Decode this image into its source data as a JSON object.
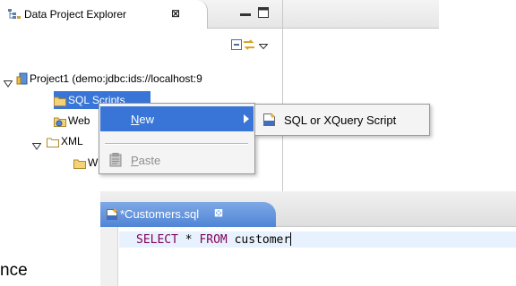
{
  "explorer": {
    "tab_title": "Data Project Explorer",
    "tab_close_glyph": "⊠",
    "tree": {
      "project": "Project1 (demo:jdbc:ids://localhost:9",
      "sql_scripts": "SQL Scripts",
      "web": "Web",
      "xml": "XML",
      "wsdl": "WSDL"
    }
  },
  "context_menu": {
    "new_mnemonic": "N",
    "new_rest": "ew",
    "paste_mnemonic": "P",
    "paste_rest": "aste"
  },
  "submenu": {
    "item": "SQL or XQuery Script"
  },
  "editor": {
    "tab_title": "*Customers.sql",
    "tab_close_glyph": "⊠",
    "code": {
      "kw1": "SELECT",
      "text1": " * ",
      "kw2": "FROM",
      "text2": " customer"
    }
  },
  "fragment_text": "nce",
  "colors": {
    "selection": "#3875d7",
    "keyword": "#7f0055",
    "disabled": "#8e8e8e"
  }
}
